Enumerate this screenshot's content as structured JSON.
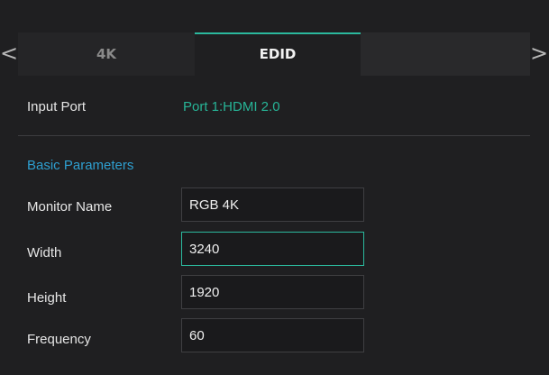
{
  "tabs": {
    "prev_arrow": "<",
    "next_arrow": ">",
    "items": [
      {
        "label": "4K",
        "active": false
      },
      {
        "label": "EDID",
        "active": true
      },
      {
        "label": "",
        "active": false
      }
    ]
  },
  "input_port": {
    "label": "Input Port",
    "value": "Port 1:HDMI 2.0"
  },
  "basic_parameters": {
    "heading": "Basic Parameters",
    "fields": {
      "monitor_name": {
        "label": "Monitor Name",
        "value": "RGB 4K"
      },
      "width": {
        "label": "Width",
        "value": "3240",
        "focused": true
      },
      "height": {
        "label": "Height",
        "value": "1920"
      },
      "frequency": {
        "label": "Frequency",
        "value": "60"
      }
    }
  },
  "colors": {
    "background": "#1f1f21",
    "accent": "#2bb99e",
    "port_value": "#27b497",
    "section_heading": "#2e9fd0",
    "text": "#e6e6e6"
  }
}
